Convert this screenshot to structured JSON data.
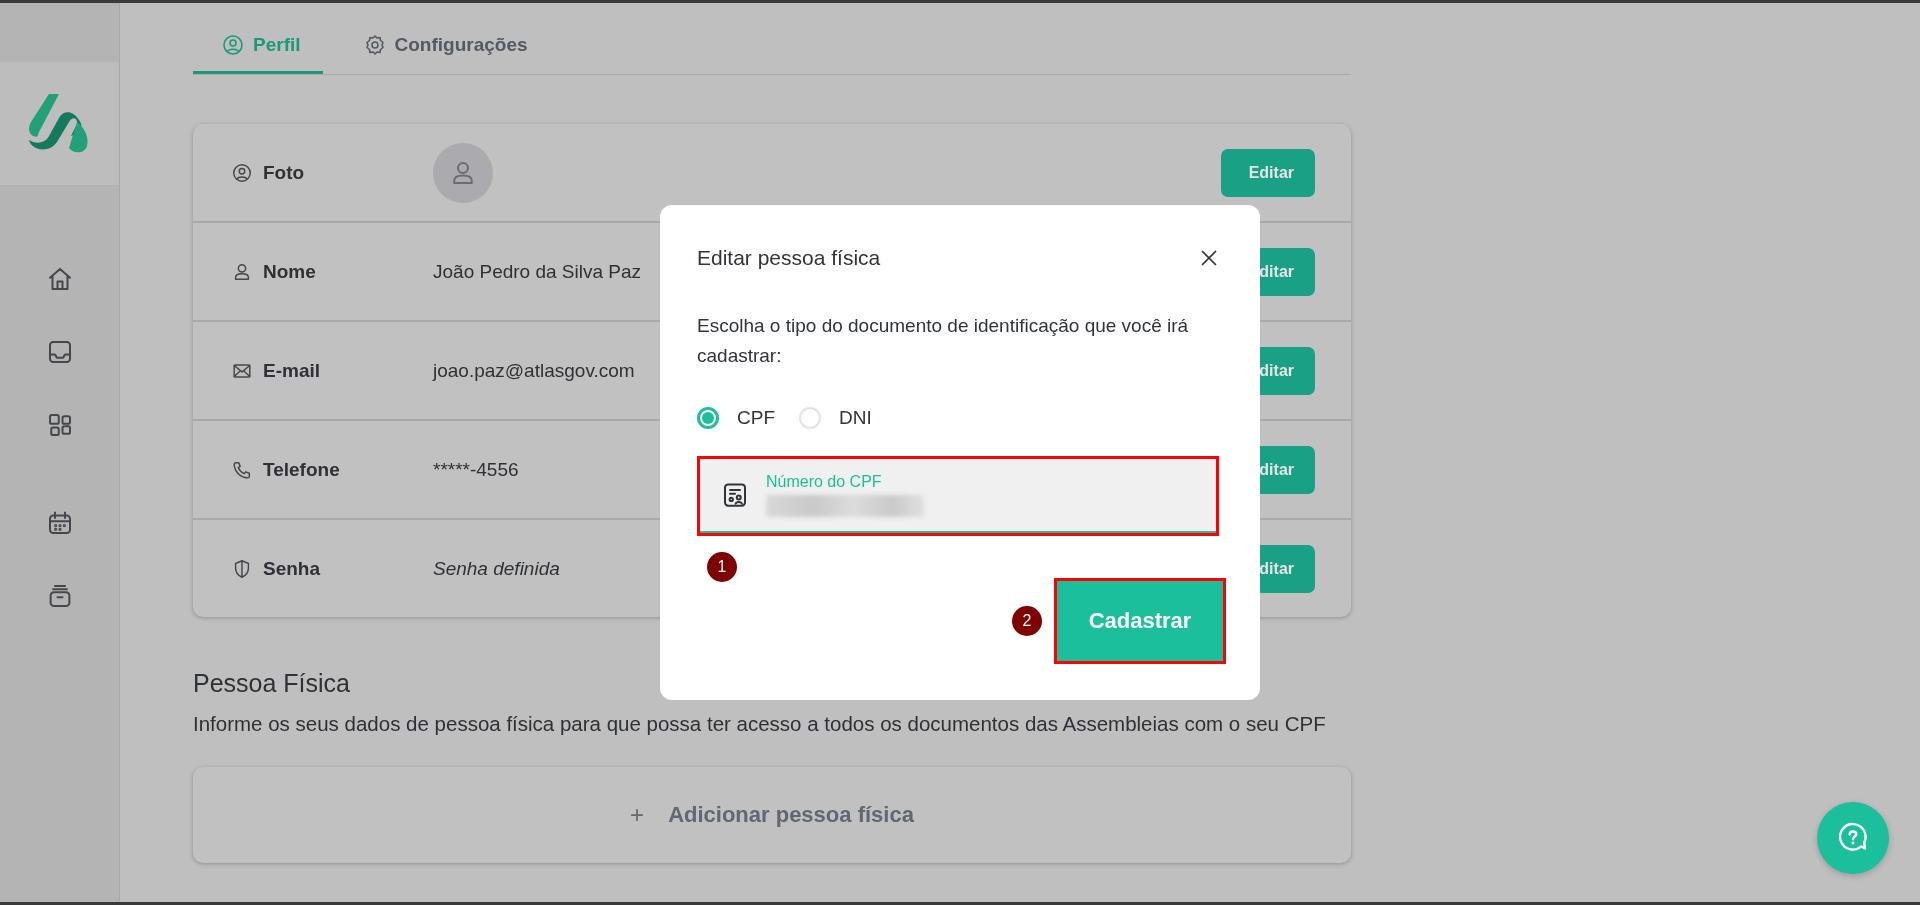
{
  "tabs": [
    {
      "label": "Perfil",
      "selected": true
    },
    {
      "label": "Configurações",
      "selected": false
    }
  ],
  "profile_rows": [
    {
      "label": "Foto",
      "kind": "avatar",
      "button": "Editar"
    },
    {
      "label": "Nome",
      "kind": "text",
      "value": "João Pedro da Silva Paz",
      "button": "ditar"
    },
    {
      "label": "E-mail",
      "kind": "text",
      "value": "joao.paz@atlasgov.com",
      "button": "ditar"
    },
    {
      "label": "Telefone",
      "kind": "text",
      "value": "*****-4556",
      "button": "ditar"
    },
    {
      "label": "Senha",
      "kind": "hint",
      "value": "Senha definida",
      "button": "ditar"
    }
  ],
  "section": {
    "title": "Pessoa Física",
    "description": "Informe os seus dados de pessoa física para que possa ter acesso a todos os documentos das Assembleias com o seu CPF",
    "add_button": {
      "icon": "+",
      "label": "Adicionar pessoa física"
    }
  },
  "modal": {
    "title": "Editar pessoa física",
    "prompt": "Escolha o tipo do documento de identificação que você irá cadastrar:",
    "options": [
      {
        "label": "CPF",
        "selected": true
      },
      {
        "label": "DNI",
        "selected": false
      }
    ],
    "field": {
      "label": "Número do CPF"
    },
    "submit": "Cadastrar",
    "markers": [
      "1",
      "2"
    ]
  }
}
